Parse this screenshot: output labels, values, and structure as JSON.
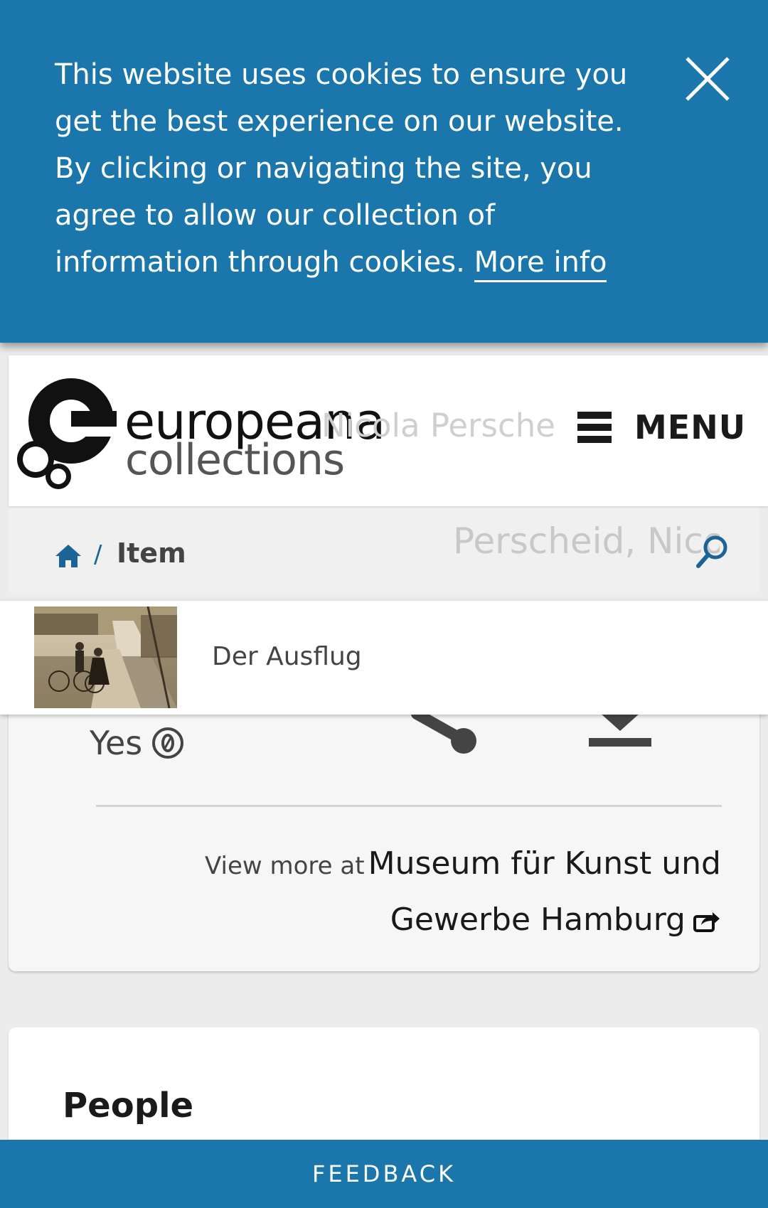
{
  "cookie_banner": {
    "text": "This website uses cookies to ensure you get the best experience on our website. By clicking or navigating the site, you agree to allow our collection of information through cookies.",
    "more_info": "More info",
    "close_icon": "close-icon"
  },
  "header": {
    "logo_line1": "europeana",
    "logo_line2": "collections",
    "search_ghost": "Nicola Perscheid",
    "menu_label": "MENU",
    "menu_icon": "hamburger-icon"
  },
  "breadcrumb": {
    "home_icon": "home-icon",
    "separator": "/",
    "current": "Item",
    "search_ghost": "Perscheid, Nicola",
    "search_icon": "search-icon"
  },
  "item_bar": {
    "title": "Der Ausflug"
  },
  "info_card": {
    "rights_label": "Yes",
    "rights_icon": "public-domain-icon",
    "share_icon": "share-icon",
    "download_icon": "download-icon",
    "view_more_prefix": "View more at",
    "provider_link": "Museum für Kunst und Gewerbe Hamburg",
    "external_icon": "external-link-icon"
  },
  "people_card": {
    "title": "People"
  },
  "feedback": {
    "label": "FEEDBACK"
  },
  "colors": {
    "brand_blue": "#1a76ab",
    "link_blue": "#1a6496"
  }
}
